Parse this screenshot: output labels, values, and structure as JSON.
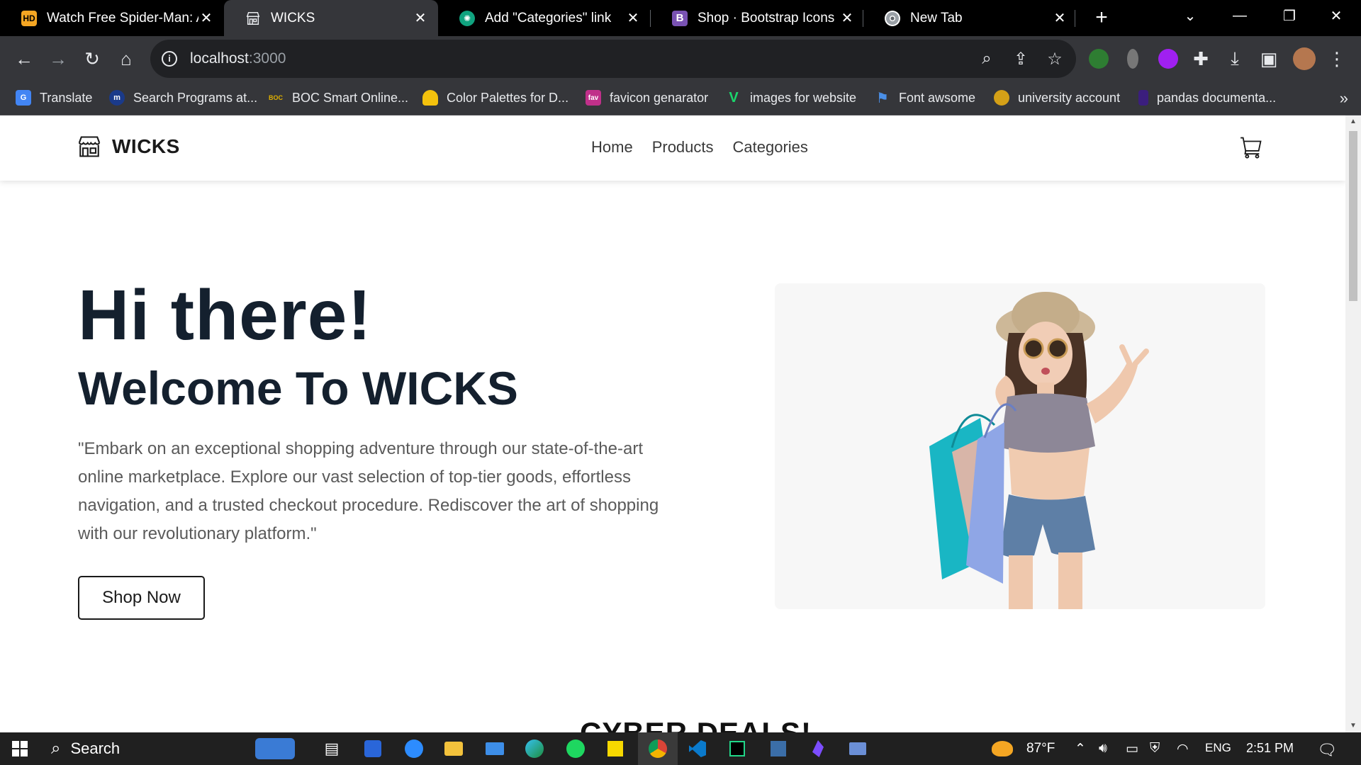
{
  "browser": {
    "tabs": [
      {
        "title": "Watch Free Spider-Man: A",
        "favicon": "HD",
        "favicon_color": "#f5a623",
        "active": false
      },
      {
        "title": "WICKS",
        "favicon": "shop-icon",
        "active": true
      },
      {
        "title": "Add \"Categories\" link",
        "favicon": "chatgpt-icon",
        "active": false
      },
      {
        "title": "Shop · Bootstrap Icons",
        "favicon": "B",
        "favicon_color": "#7952b3",
        "active": false
      },
      {
        "title": "New Tab",
        "favicon": "chrome-icon",
        "active": false
      }
    ],
    "url": {
      "host": "localhost",
      "port": ":3000"
    },
    "bookmarks": [
      {
        "label": "Translate",
        "icon": "G",
        "color": "#4285f4"
      },
      {
        "label": "Search Programs at...",
        "icon": "m",
        "color": "#1a3a8a"
      },
      {
        "label": "BOC Smart Online...",
        "icon": "BOC",
        "color": "#e0b000"
      },
      {
        "label": "Color Palettes for D...",
        "icon": "palette",
        "color": "#f4c20d"
      },
      {
        "label": "favicon genarator",
        "icon": "fav",
        "color": "#c0308a"
      },
      {
        "label": "images for website",
        "icon": "V",
        "color": "#1bd66c"
      },
      {
        "label": "Font awsome",
        "icon": "flag",
        "color": "#4a8fe7"
      },
      {
        "label": "university account",
        "icon": "U",
        "color": "#d4a017"
      },
      {
        "label": "pandas documenta...",
        "icon": "pd",
        "color": "#3b1e7d"
      }
    ]
  },
  "site": {
    "brand": "WICKS",
    "nav": [
      "Home",
      "Products",
      "Categories"
    ],
    "hero": {
      "title": "Hi there!",
      "subtitle": "Welcome To WICKS",
      "description": "\"Embark on an exceptional shopping adventure through our state-of-the-art online marketplace. Explore our vast selection of top-tier goods, effortless navigation, and a trusted checkout procedure. Rediscover the art of shopping with our revolutionary platform.\"",
      "button": "Shop Now"
    },
    "next_section_title": "CYBER DEALS!"
  },
  "taskbar": {
    "search_placeholder": "Search",
    "weather": "87°F",
    "language": "ENG",
    "time": "2:51 PM"
  }
}
